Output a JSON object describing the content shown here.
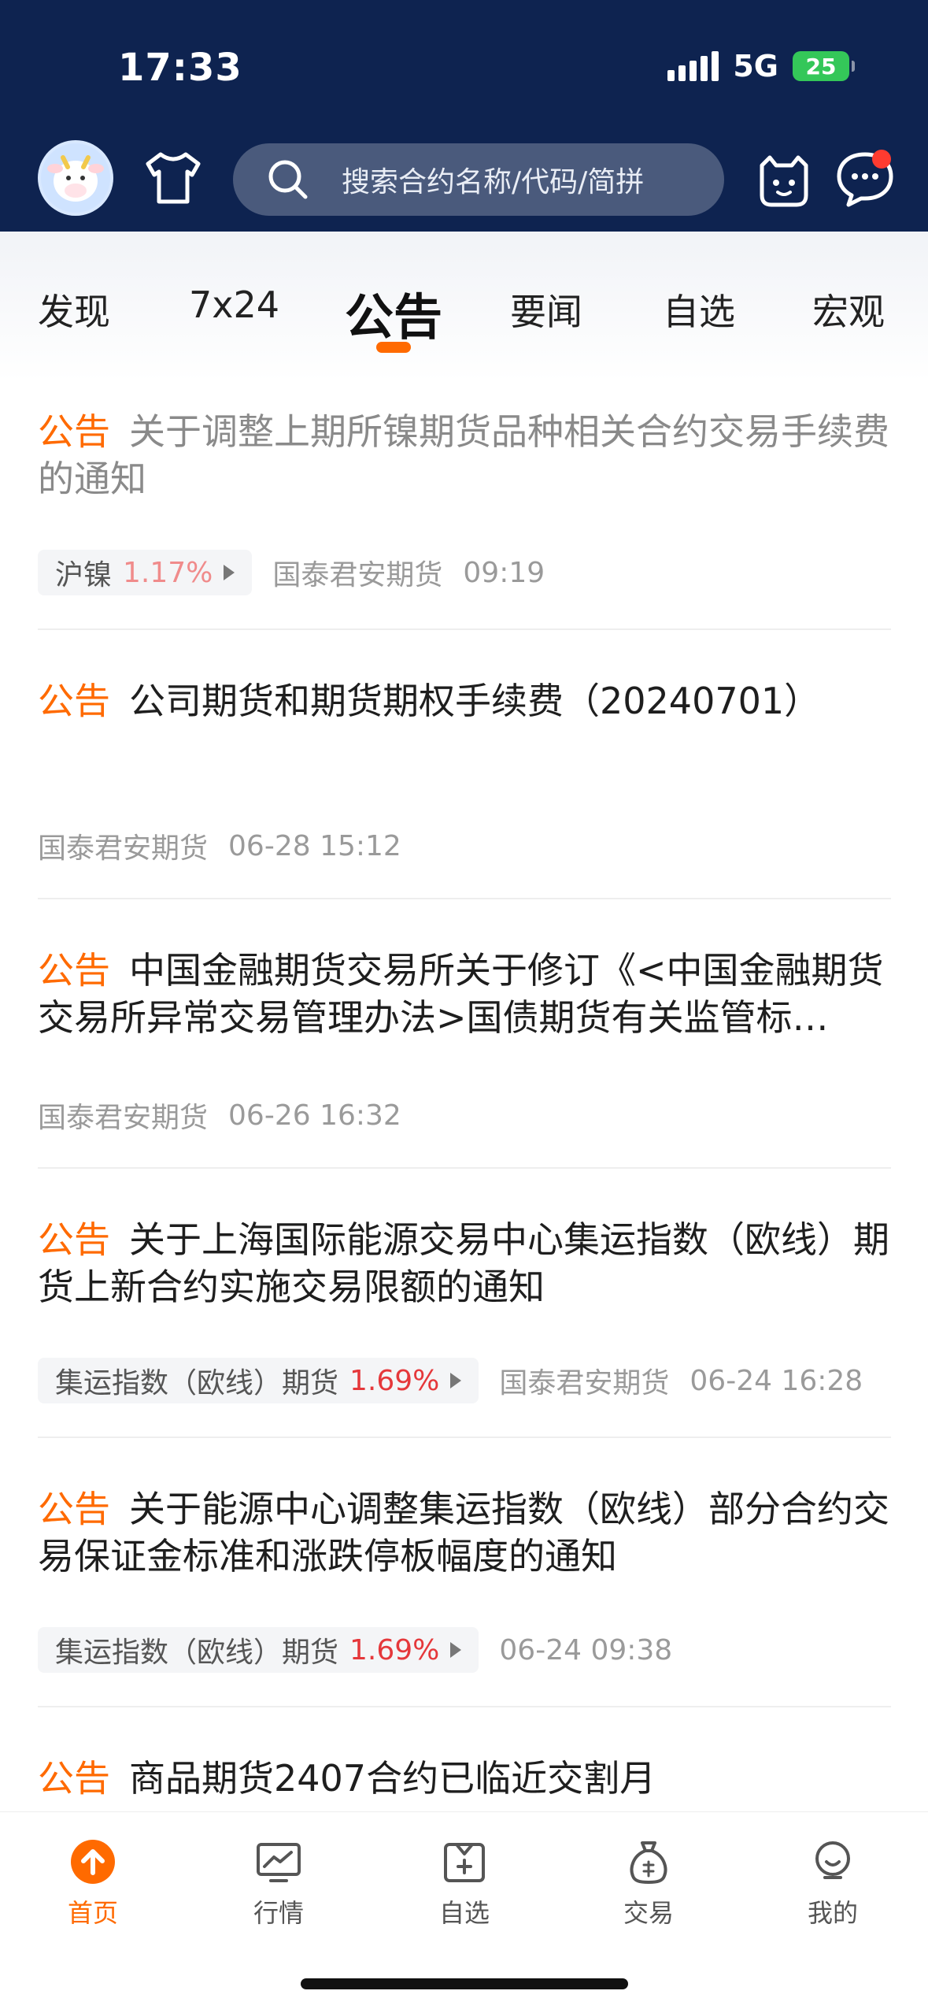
{
  "status_bar": {
    "time": "17:33",
    "network": "5G",
    "battery": "25"
  },
  "header": {
    "search_placeholder": "搜索合约名称/代码/简拼"
  },
  "tabs": [
    {
      "label": "发现"
    },
    {
      "label": "7x24"
    },
    {
      "label": "公告",
      "active": true
    },
    {
      "label": "要闻"
    },
    {
      "label": "自选"
    },
    {
      "label": "宏观"
    }
  ],
  "accent_color": "#ff6a00",
  "items": [
    {
      "tag": "公告",
      "title": "关于调整上期所镍期货品种相关合约交易手续费的通知",
      "read": true,
      "chip": {
        "name": "沪镍",
        "pct": "1.17%"
      },
      "source": "国泰君安期货",
      "time": "09:19"
    },
    {
      "tag": "公告",
      "title": "公司期货和期货期权手续费（20240701）",
      "source": "国泰君安期货",
      "time": "06-28 15:12"
    },
    {
      "tag": "公告",
      "title": "中国金融期货交易所关于修订《<中国金融期货交易所异常交易管理办法>国债期货有关监管标…",
      "source": "国泰君安期货",
      "time": "06-26 16:32"
    },
    {
      "tag": "公告",
      "title": "关于上海国际能源交易中心集运指数（欧线）期货上新合约实施交易限额的通知",
      "chip": {
        "name": "集运指数（欧线）期货",
        "pct": "1.69%"
      },
      "source": "国泰君安期货",
      "time": "06-24 16:28"
    },
    {
      "tag": "公告",
      "title": "关于能源中心调整集运指数（欧线）部分合约交易保证金标准和涨跌停板幅度的通知",
      "chip": {
        "name": "集运指数（欧线）期货",
        "pct": "1.69%"
      },
      "time": "06-24 09:38"
    },
    {
      "tag": "公告",
      "title": "商品期货2407合约已临近交割月"
    }
  ],
  "bottom_nav": [
    {
      "label": "首页",
      "active": true
    },
    {
      "label": "行情"
    },
    {
      "label": "自选"
    },
    {
      "label": "交易"
    },
    {
      "label": "我的"
    }
  ]
}
